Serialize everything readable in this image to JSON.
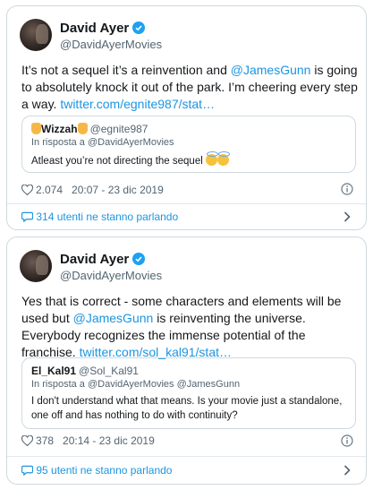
{
  "tweets": [
    {
      "author_name": "David Ayer",
      "author_handle": "@DavidAyerMovies",
      "text_before": "It’s not a sequel it’s a reinvention and ",
      "mention": "@JamesGunn",
      "text_after": " is going to absolutely knock it out of the park. I’m cheering every step a way. ",
      "link": "twitter.com/egnite987/stat…",
      "quote": {
        "name": "Wizzah",
        "handle": "@egnite987",
        "reply_label": "In risposta a @DavidAyerMovies",
        "text": "Atleast you’re not directing the sequel"
      },
      "likes": "2.074",
      "timestamp": "20:07 - 23 dic 2019",
      "talking": "314 utenti ne stanno parlando"
    },
    {
      "author_name": "David Ayer",
      "author_handle": "@DavidAyerMovies",
      "text_before": "Yes that is correct - some characters and elements will be used but ",
      "mention": "@JamesGunn",
      "text_after": " is reinventing the universe. Everybody recognizes the immense potential of the franchise. ",
      "link": "twitter.com/sol_kal91/stat…",
      "quote": {
        "name": "El_Kal91",
        "handle": "@Sol_Kal91",
        "reply_label": "In risposta a @DavidAyerMovies @JamesGunn",
        "text": "I don't understand what that means. Is your movie just a standalone, one off and has nothing to do with continuity?"
      },
      "likes": "378",
      "timestamp": "20:14 - 23 dic 2019",
      "talking": "95 utenti ne stanno parlando"
    }
  ],
  "icons": {
    "verified": "verified-badge-icon",
    "like": "heart-icon",
    "info": "info-icon",
    "talk": "speech-bubble-icon",
    "chevron": "chevron-right-icon"
  },
  "colors": {
    "accent": "#1b95e0",
    "verified": "#1da1f2",
    "muted": "#536471",
    "border": "#cfd9de"
  }
}
